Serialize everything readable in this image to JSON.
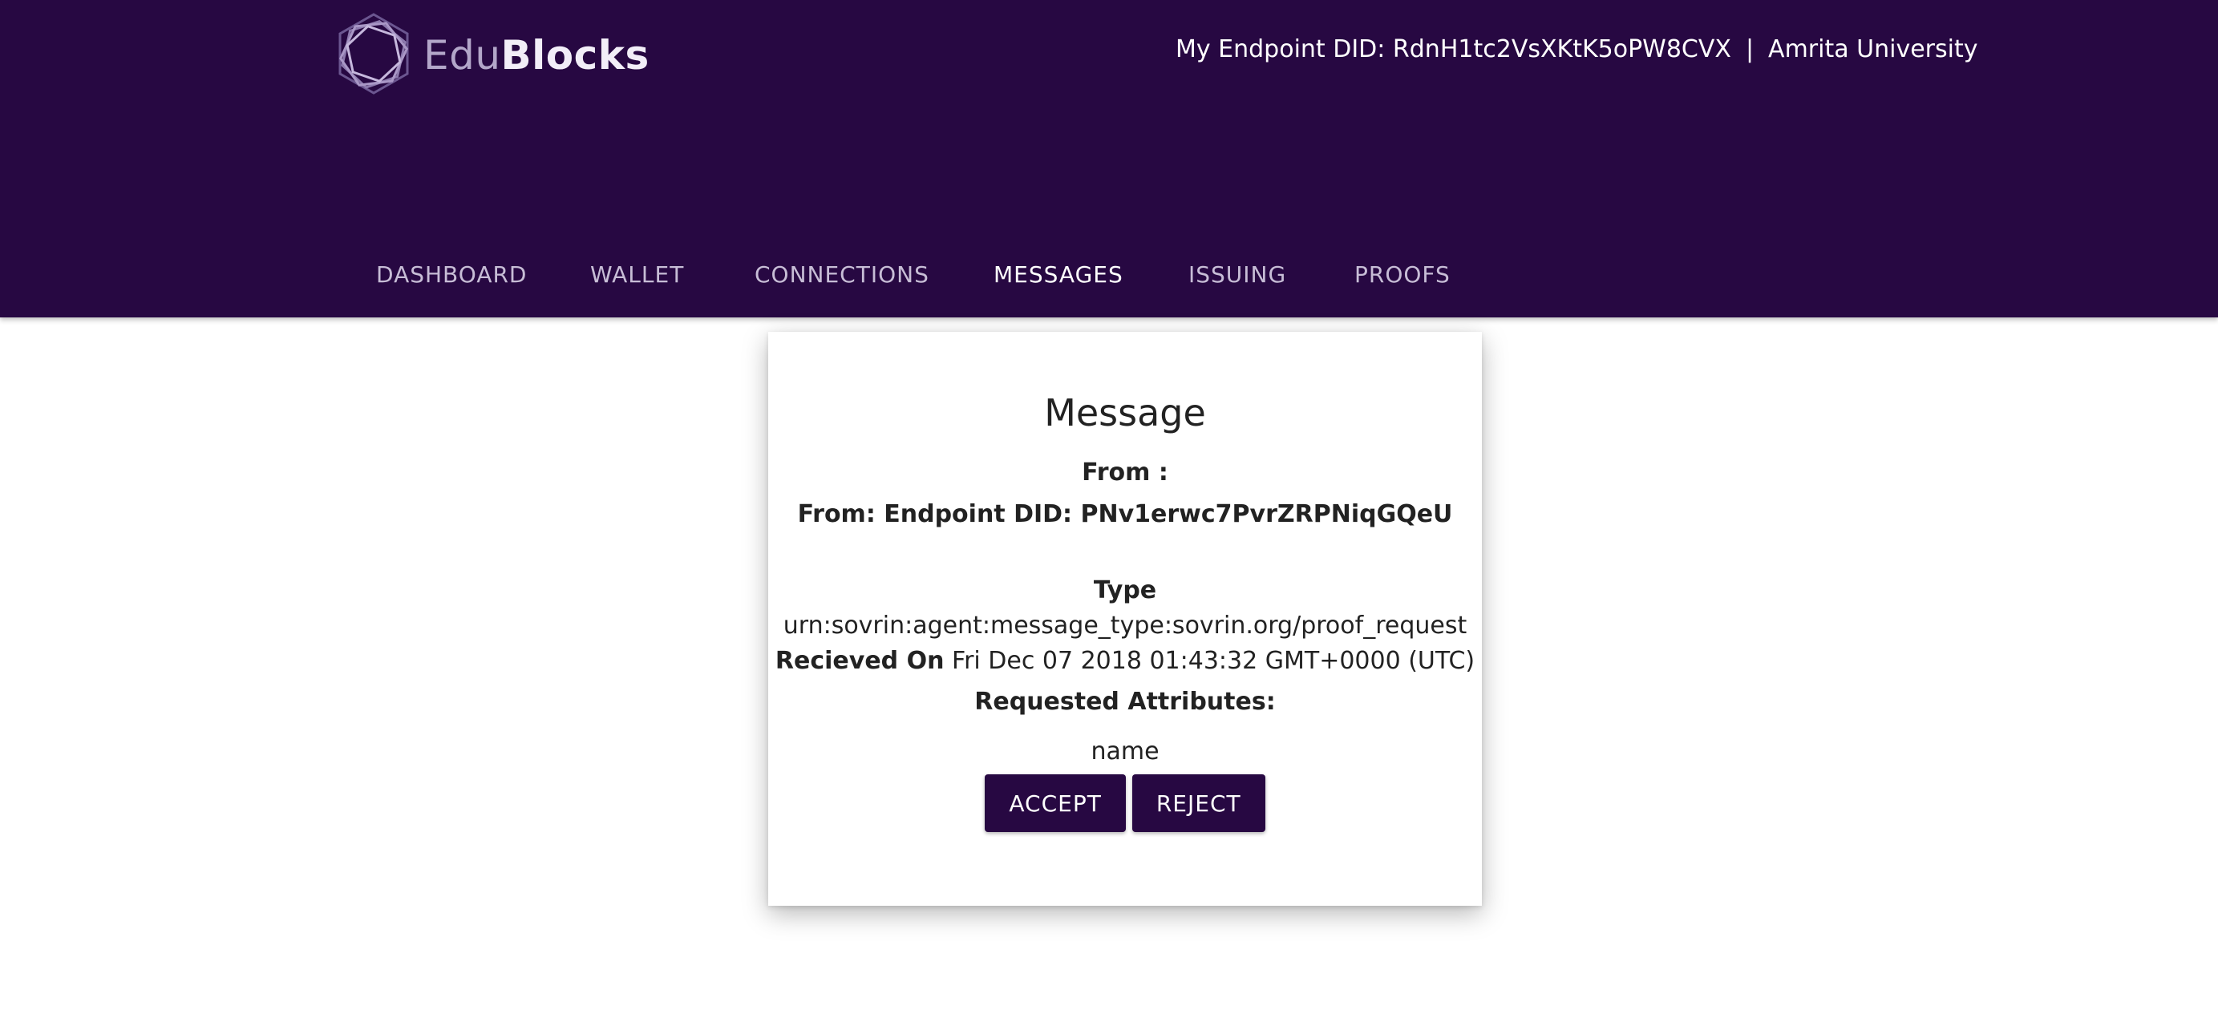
{
  "brand": {
    "logo_icon": "hexagon-logo-icon",
    "name_part1": "Edu",
    "name_part2": "Blocks"
  },
  "header": {
    "endpoint_did": "My Endpoint DID: RdnH1tc2VsXKtK5oPW8CVX",
    "separator": "|",
    "organization": "Amrita University"
  },
  "nav": {
    "items": [
      {
        "label": "DASHBOARD"
      },
      {
        "label": "WALLET"
      },
      {
        "label": "CONNECTIONS"
      },
      {
        "label": "MESSAGES"
      },
      {
        "label": "ISSUING"
      },
      {
        "label": "PROOFS"
      }
    ],
    "active": "MESSAGES"
  },
  "message": {
    "title": "Message",
    "from_label": "From :",
    "from_value": "From: Endpoint DID: PNv1erwc7PvrZRPNiqGQeU",
    "type_label": "Type",
    "type_value": "urn:sovrin:agent:message_type:sovrin.org/proof_request",
    "received_label": "Recieved On",
    "received_value": "Fri Dec 07 2018 01:43:32 GMT+0000 (UTC)",
    "requested_attributes_label": "Requested Attributes:",
    "requested_attributes": [
      "name"
    ],
    "accept_label": "ACCEPT",
    "reject_label": "REJECT"
  },
  "colors": {
    "header_bg": "#270842",
    "button_bg": "#270842",
    "text": "#222222"
  }
}
